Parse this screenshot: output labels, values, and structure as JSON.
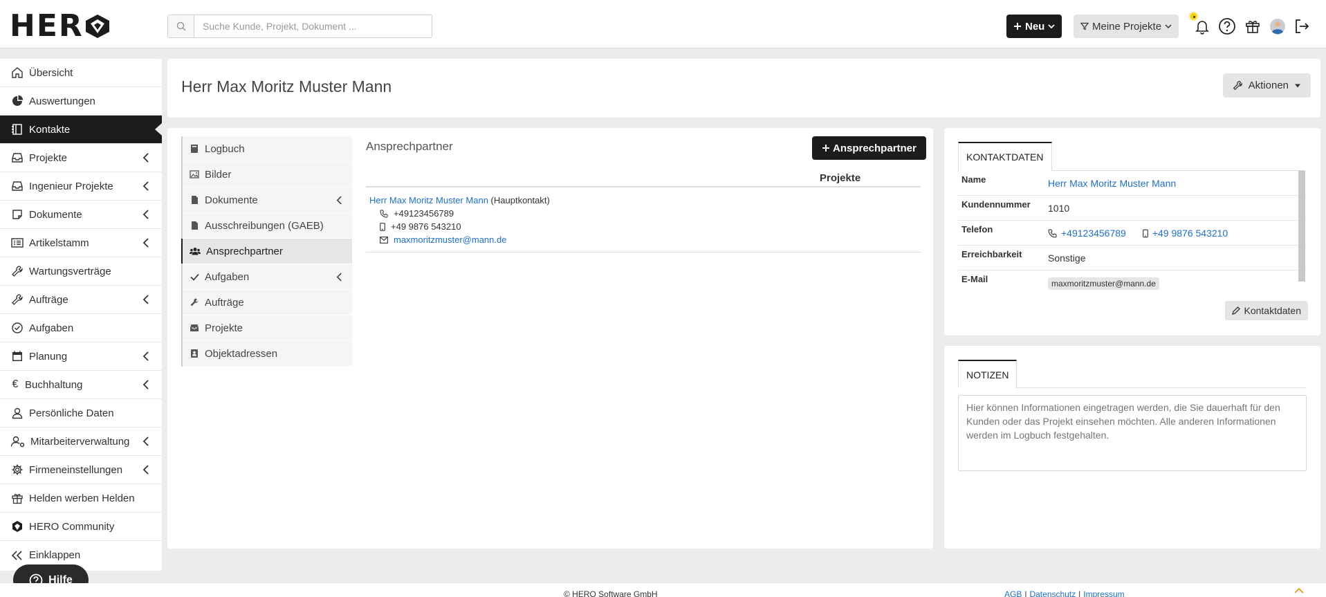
{
  "header": {
    "logo_text": "HER",
    "search_placeholder": "Suche Kunde, Projekt, Dokument ...",
    "new_button": "Neu",
    "filter_button": "Meine Projekte"
  },
  "sidebar": {
    "items": [
      {
        "label": "Übersicht",
        "icon": "home-icon",
        "has_submenu": false,
        "active": false
      },
      {
        "label": "Auswertungen",
        "icon": "pie-chart-icon",
        "has_submenu": false,
        "active": false
      },
      {
        "label": "Kontakte",
        "icon": "address-book-icon",
        "has_submenu": false,
        "active": true
      },
      {
        "label": "Projekte",
        "icon": "inbox-icon",
        "has_submenu": true,
        "active": false
      },
      {
        "label": "Ingenieur Projekte",
        "icon": "inbox-icon",
        "has_submenu": true,
        "active": false
      },
      {
        "label": "Dokumente",
        "icon": "note-icon",
        "has_submenu": true,
        "active": false
      },
      {
        "label": "Artikelstamm",
        "icon": "list-icon",
        "has_submenu": true,
        "active": false
      },
      {
        "label": "Wartungsverträge",
        "icon": "wrench-icon",
        "has_submenu": false,
        "active": false
      },
      {
        "label": "Aufträge",
        "icon": "wrench-icon",
        "has_submenu": true,
        "active": false
      },
      {
        "label": "Aufgaben",
        "icon": "check-circle-icon",
        "has_submenu": false,
        "active": false
      },
      {
        "label": "Planung",
        "icon": "calendar-icon",
        "has_submenu": true,
        "active": false
      },
      {
        "label": "Buchhaltung",
        "icon": "euro-icon",
        "has_submenu": true,
        "active": false
      },
      {
        "label": "Persönliche Daten",
        "icon": "user-icon",
        "has_submenu": false,
        "active": false
      },
      {
        "label": "Mitarbeiterverwaltung",
        "icon": "users-gear-icon",
        "has_submenu": true,
        "active": false
      },
      {
        "label": "Firmeneinstellungen",
        "icon": "gear-icon",
        "has_submenu": true,
        "active": false
      },
      {
        "label": "Helden werben Helden",
        "icon": "gift-icon",
        "has_submenu": false,
        "active": false
      },
      {
        "label": "HERO Community",
        "icon": "hero-logo-icon",
        "has_submenu": false,
        "active": false
      },
      {
        "label": "Einklappen",
        "icon": "collapse-icon",
        "has_submenu": false,
        "active": false
      }
    ]
  },
  "help_button": "Hilfe",
  "page": {
    "title": "Herr Max Moritz Muster Mann",
    "actions_button": "Aktionen"
  },
  "subnav": {
    "items": [
      {
        "label": "Logbuch",
        "icon": "book-icon",
        "has_submenu": false,
        "active": false
      },
      {
        "label": "Bilder",
        "icon": "image-icon",
        "has_submenu": false,
        "active": false
      },
      {
        "label": "Dokumente",
        "icon": "file-icon",
        "has_submenu": true,
        "active": false
      },
      {
        "label": "Ausschreibungen (GAEB)",
        "icon": "file-icon",
        "has_submenu": false,
        "active": false
      },
      {
        "label": "Ansprechpartner",
        "icon": "users-icon",
        "has_submenu": false,
        "active": true
      },
      {
        "label": "Aufgaben",
        "icon": "check-icon",
        "has_submenu": true,
        "active": false
      },
      {
        "label": "Aufträge",
        "icon": "wrench-icon",
        "has_submenu": false,
        "active": false
      },
      {
        "label": "Projekte",
        "icon": "inbox-icon",
        "has_submenu": false,
        "active": false
      },
      {
        "label": "Objektadressen",
        "icon": "contact-card-icon",
        "has_submenu": false,
        "active": false
      }
    ]
  },
  "ansprechpartner": {
    "title": "Ansprechpartner",
    "add_button": "Ansprechpartner",
    "column_projekte": "Projekte",
    "contact": {
      "name": "Herr Max Moritz Muster Mann",
      "tag": "(Hauptkontakt)",
      "phone": "+49123456789",
      "mobile": "+49 9876 543210",
      "email": "maxmoritzmuster@mann.de"
    }
  },
  "kontaktdaten": {
    "tab": "KONTAKTDATEN",
    "rows": {
      "name_label": "Name",
      "name_value": "Herr Max Moritz Muster Mann",
      "kundennummer_label": "Kundennummer",
      "kundennummer_value": "1010",
      "telefon_label": "Telefon",
      "telefon_value": "+49123456789",
      "mobil_value": "+49 9876 543210",
      "erreichbarkeit_label": "Erreichbarkeit",
      "erreichbarkeit_value": "Sonstige",
      "email_label": "E-Mail",
      "email_value": "maxmoritzmuster@mann.de"
    },
    "edit_button": "Kontaktdaten"
  },
  "notizen": {
    "tab": "NOTIZEN",
    "placeholder": "Hier können Informationen eingetragen werden, die Sie dauerhaft für den Kunden oder das Projekt einsehen möchten. Alle anderen Informationen werden im Logbuch festgehalten."
  },
  "footer": {
    "copyright": "© HERO Software GmbH",
    "links": [
      "AGB",
      "Datenschutz",
      "Impressum"
    ],
    "separator": "|"
  },
  "colors": {
    "accent": "#1c1c1c",
    "link": "#1d6fd1",
    "notification": "#f4d200"
  }
}
